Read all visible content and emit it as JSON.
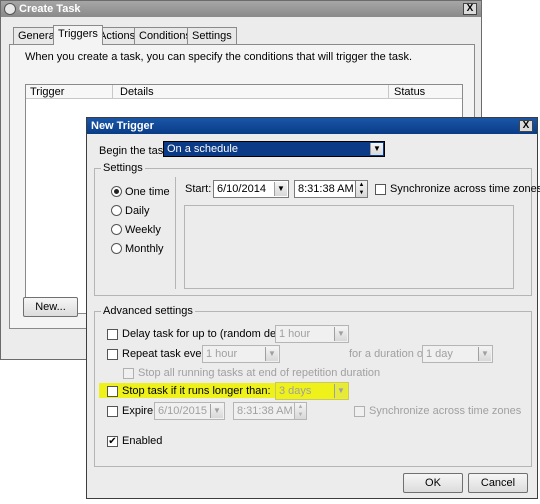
{
  "create_task": {
    "title": "Create Task",
    "close": "X",
    "tabs": [
      "General",
      "Triggers",
      "Actions",
      "Conditions",
      "Settings"
    ],
    "description": "When you create a task, you can specify the conditions that will trigger the task.",
    "columns": [
      "Trigger",
      "Details",
      "Status"
    ],
    "new_button": "New..."
  },
  "new_trigger": {
    "title": "New Trigger",
    "close": "X",
    "begin_label": "Begin the task:",
    "begin_value": "On a schedule",
    "settings_label": "Settings",
    "schedule_options": [
      "One time",
      "Daily",
      "Weekly",
      "Monthly"
    ],
    "selected_option": "One time",
    "start_label": "Start:",
    "start_date": "6/10/2014",
    "start_time": "8:31:38 AM",
    "sync_label": "Synchronize across time zones",
    "advanced_label": "Advanced settings",
    "delay_label": "Delay task for up to (random delay):",
    "delay_value": "1 hour",
    "repeat_label": "Repeat task every:",
    "repeat_value": "1 hour",
    "duration_label": "for a duration of:",
    "duration_value": "1 day",
    "stop_running_label": "Stop all running tasks at end of repetition duration",
    "stop_longer_label": "Stop task if it runs longer than:",
    "stop_longer_value": "3 days",
    "expire_label": "Expire:",
    "expire_date": "6/10/2015",
    "expire_time": "8:31:38 AM",
    "expire_sync_label": "Synchronize across time zones",
    "enabled_label": "Enabled",
    "enabled_checked": "✔",
    "ok": "OK",
    "cancel": "Cancel"
  },
  "colors": {
    "title_active": "#0a3c86",
    "title_inactive": "#8a8a8a",
    "highlight": "#eef21a"
  }
}
